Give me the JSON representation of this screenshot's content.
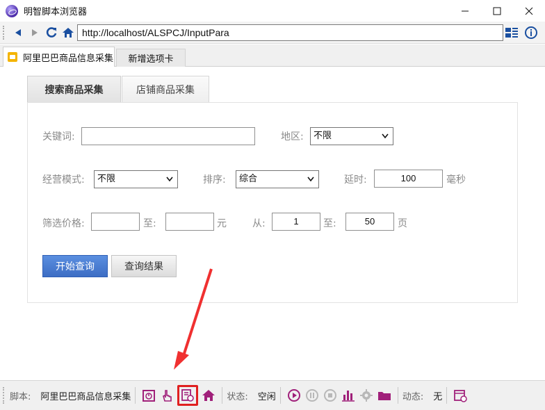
{
  "window": {
    "title": "明智脚本浏览器"
  },
  "toolbar": {
    "url": "http://localhost/ALSPCJ/InputPara"
  },
  "tabs": [
    {
      "label": "阿里巴巴商品信息采集"
    },
    {
      "label": "新增选项卡"
    }
  ],
  "form": {
    "tabs": [
      {
        "label": "搜索商品采集"
      },
      {
        "label": "店铺商品采集"
      }
    ],
    "keyword_label": "关键词:",
    "keyword_value": "",
    "region_label": "地区:",
    "region_value": "不限",
    "mode_label": "经营模式:",
    "mode_value": "不限",
    "sort_label": "排序:",
    "sort_value": "综合",
    "delay_label": "延时:",
    "delay_value": "100",
    "delay_unit": "毫秒",
    "price_label": "筛选价格:",
    "price_from": "",
    "price_to_label": "至:",
    "price_to": "",
    "price_unit": "元",
    "page_from_label": "从:",
    "page_from": "1",
    "page_to_label": "至:",
    "page_to": "50",
    "page_unit": "页",
    "start_button": "开始查询",
    "result_button": "查询结果"
  },
  "statusbar": {
    "script_label": "脚本:",
    "script_value": "阿里巴巴商品信息采集",
    "state_label": "状态:",
    "state_value": "空闲",
    "dynamic_label": "动态:",
    "dynamic_value": "无"
  },
  "colors": {
    "accent": "#3d6dc4",
    "highlight": "#e02020",
    "icon_purple": "#a0207a"
  }
}
